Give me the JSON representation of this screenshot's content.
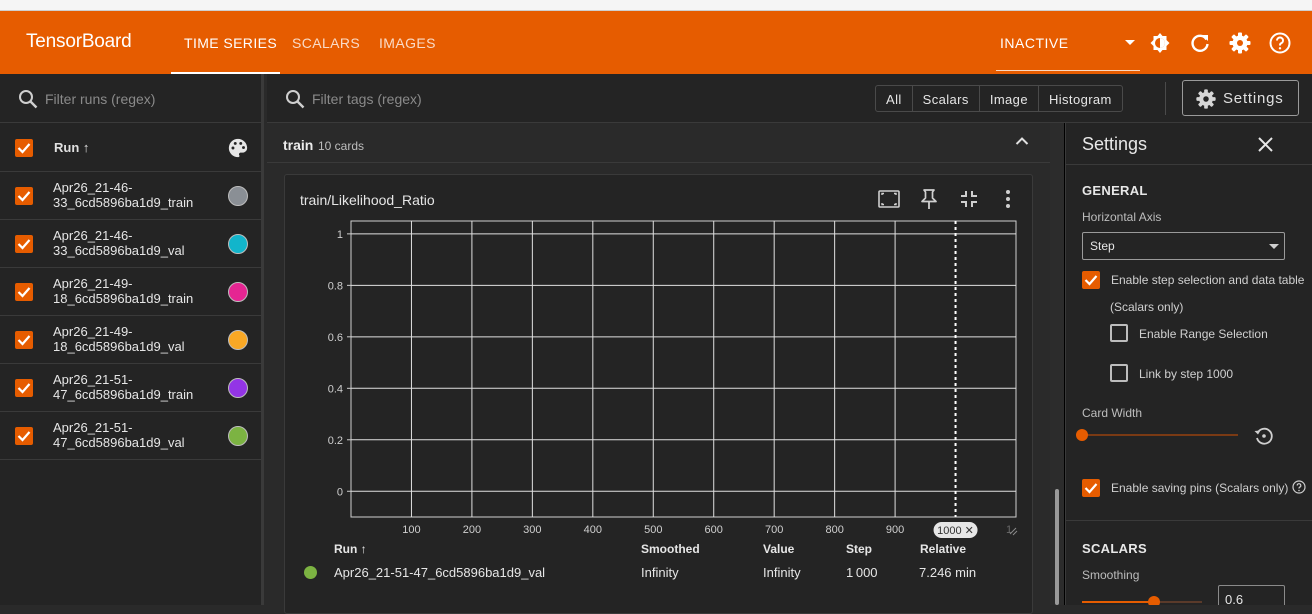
{
  "app": {
    "brand": "TensorBoard",
    "tabs": [
      {
        "label": "TIME SERIES",
        "active": true
      },
      {
        "label": "SCALARS",
        "active": false
      },
      {
        "label": "IMAGES",
        "active": false
      }
    ],
    "status": "INACTIVE",
    "accent_color": "#e65c00",
    "header_icons": [
      "theme-toggle-icon",
      "reload-icon",
      "settings-gear-icon",
      "help-icon"
    ]
  },
  "runs_panel": {
    "filter_placeholder": "Filter runs (regex)",
    "header_label": "Run ↑",
    "runs": [
      {
        "name": "Apr26_21-46-33_6cd5896ba1d9_train",
        "line1": "Apr26_21-46-",
        "line2": "33_6cd5896ba1d9_train",
        "color": "#8a8f95",
        "checked": true
      },
      {
        "name": "Apr26_21-46-33_6cd5896ba1d9_val",
        "line1": "Apr26_21-46-",
        "line2": "33_6cd5896ba1d9_val",
        "color": "#12b5cb",
        "checked": true
      },
      {
        "name": "Apr26_21-49-18_6cd5896ba1d9_train",
        "line1": "Apr26_21-49-",
        "line2": "18_6cd5896ba1d9_train",
        "color": "#e52592",
        "checked": true
      },
      {
        "name": "Apr26_21-49-18_6cd5896ba1d9_val",
        "line1": "Apr26_21-49-",
        "line2": "18_6cd5896ba1d9_val",
        "color": "#f9a825",
        "checked": true
      },
      {
        "name": "Apr26_21-51-47_6cd5896ba1d9_train",
        "line1": "Apr26_21-51-",
        "line2": "47_6cd5896ba1d9_train",
        "color": "#9334e6",
        "checked": true
      },
      {
        "name": "Apr26_21-51-47_6cd5896ba1d9_val",
        "line1": "Apr26_21-51-",
        "line2": "47_6cd5896ba1d9_val",
        "color": "#7cb342",
        "checked": true
      }
    ]
  },
  "toolbar": {
    "filter_placeholder": "Filter tags (regex)",
    "type_filters": [
      "All",
      "Scalars",
      "Image",
      "Histogram"
    ],
    "settings_label": "Settings"
  },
  "group": {
    "name": "train",
    "count_label": "10 cards"
  },
  "card": {
    "title": "train/Likelihood_Ratio",
    "chart_data": {
      "type": "line",
      "title": "train/Likelihood_Ratio",
      "xlabel": "",
      "ylabel": "",
      "x_ticks": [
        100,
        200,
        300,
        400,
        500,
        600,
        700,
        800,
        900
      ],
      "y_ticks": [
        0,
        0.2,
        0.4,
        0.6,
        0.8,
        1
      ],
      "y_tick_labels": [
        "0",
        "0.2",
        "0.4",
        "0.6",
        "0.8",
        "1"
      ],
      "xlim": [
        0,
        1100
      ],
      "ylim": [
        -0.1,
        1.05
      ],
      "grid": true,
      "series": [],
      "step_marker": {
        "step": 1000,
        "label": "1000 ✕"
      }
    },
    "legend_headers": [
      "Run ↑",
      "Smoothed",
      "Value",
      "Step",
      "Relative"
    ],
    "legend_rows": [
      {
        "run": "Apr26_21-51-47_6cd5896ba1d9_val",
        "color": "#7cb342",
        "smoothed": "Infinity",
        "value": "Infinity",
        "step": "1 000",
        "relative": "7.246 min"
      }
    ]
  },
  "settings": {
    "title": "Settings",
    "general_label": "GENERAL",
    "horizontal_axis_label": "Horizontal Axis",
    "horizontal_axis_value": "Step",
    "step_selection_label": "Enable step selection and data table",
    "scalars_only_note": "(Scalars only)",
    "range_selection_label": "Enable Range Selection",
    "link_by_step_label": "Link by step 1000",
    "card_width_label": "Card Width",
    "saving_pins_label": "Enable saving pins (Scalars only)",
    "scalars_label": "SCALARS",
    "smoothing_label": "Smoothing",
    "smoothing_value": "0.6",
    "smoothing_fraction": 0.6,
    "card_width_fraction": 0.0
  }
}
